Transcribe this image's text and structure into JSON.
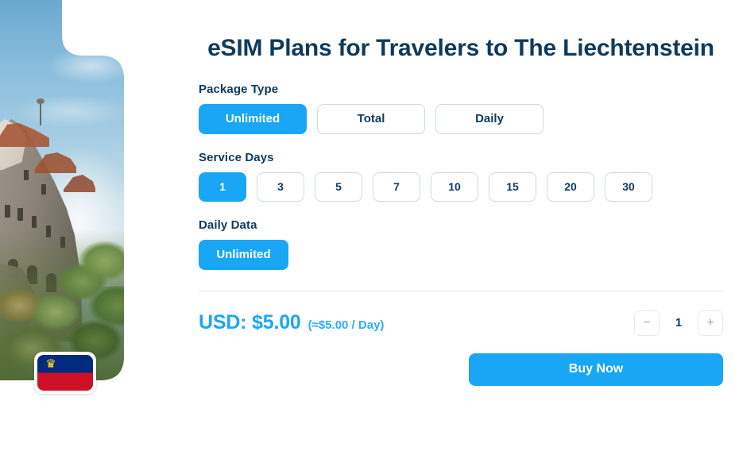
{
  "hero": {
    "alt_description": "Vaduz Castle on a hillside under blue sky",
    "flag": {
      "name": "liechtenstein-flag",
      "crown_glyph": "♛",
      "blue": "#002B7F",
      "red": "#CE1126",
      "crown_color": "#FFD83D"
    }
  },
  "page_title": "eSIM Plans for Travelers to The Liechtenstein",
  "theme": {
    "accent": "#18A6F5",
    "price_color": "#1CA7F5",
    "text_dark": "#0E3A5E",
    "border": "#cfd9e2"
  },
  "package_type": {
    "label": "Package Type",
    "options": [
      {
        "label": "Unlimited",
        "selected": true
      },
      {
        "label": "Total",
        "selected": false
      },
      {
        "label": "Daily",
        "selected": false
      }
    ]
  },
  "service_days": {
    "label": "Service Days",
    "options": [
      {
        "label": "1",
        "selected": true
      },
      {
        "label": "3",
        "selected": false
      },
      {
        "label": "5",
        "selected": false
      },
      {
        "label": "7",
        "selected": false
      },
      {
        "label": "10",
        "selected": false
      },
      {
        "label": "15",
        "selected": false
      },
      {
        "label": "20",
        "selected": false
      },
      {
        "label": "30",
        "selected": false
      }
    ]
  },
  "daily_data": {
    "label": "Daily Data",
    "options": [
      {
        "label": "Unlimited",
        "selected": true
      }
    ]
  },
  "pricing": {
    "total": "USD: $5.00",
    "per_day": "(≈$5.00 / Day)"
  },
  "quantity": {
    "decrement_label": "−",
    "value": "1",
    "increment_label": "+"
  },
  "buy": {
    "label": "Buy Now"
  }
}
